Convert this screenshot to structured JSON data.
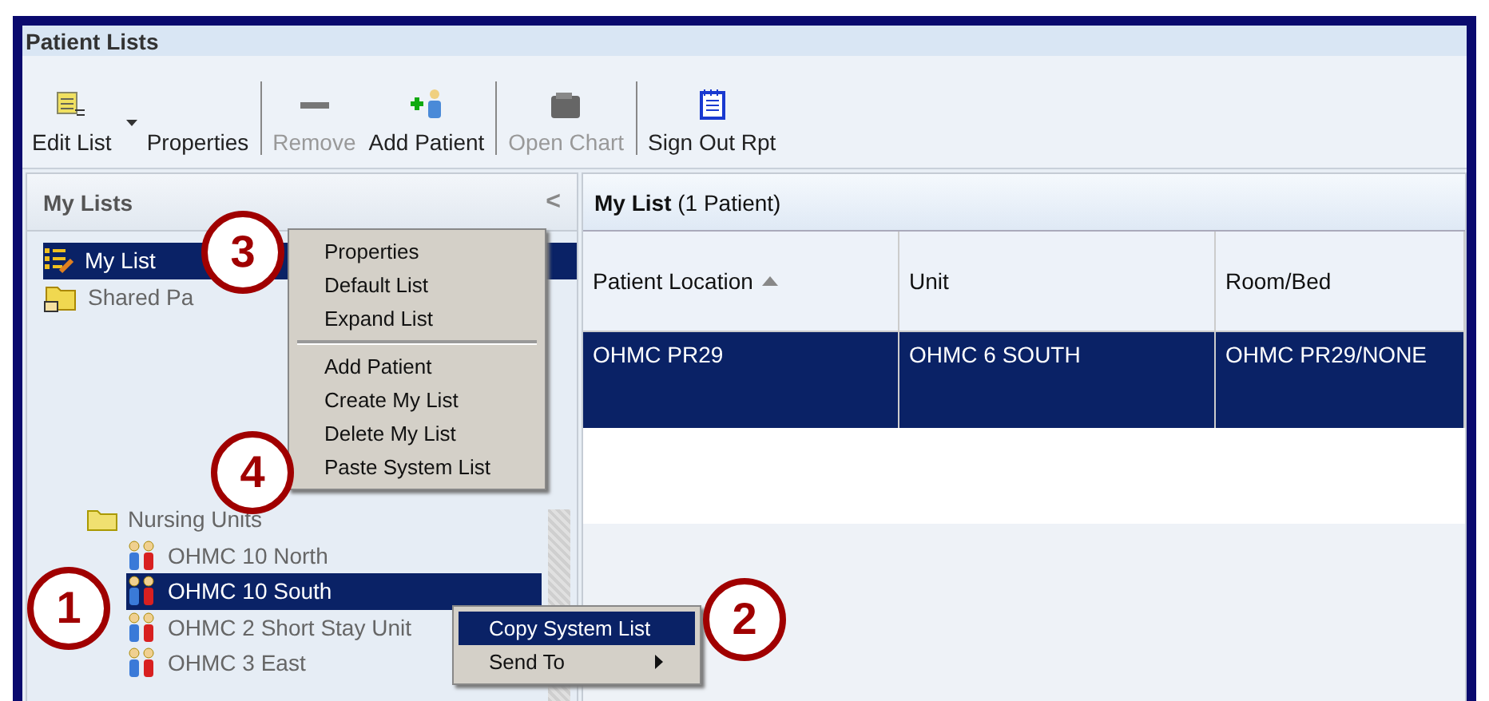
{
  "window": {
    "title": "Patient Lists"
  },
  "toolbar": [
    {
      "label": "Edit List",
      "disabled": false,
      "has_dropdown": true,
      "kind": "edit-list"
    },
    {
      "label": "Properties",
      "disabled": false,
      "kind": "none"
    },
    {
      "label": "Remove",
      "disabled": true,
      "kind": "remove"
    },
    {
      "label": "Add Patient",
      "disabled": false,
      "kind": "add-patient"
    },
    {
      "label": "Open Chart",
      "disabled": true,
      "kind": "chart"
    },
    {
      "label": "Sign Out Rpt",
      "disabled": false,
      "kind": "report"
    }
  ],
  "sidebar": {
    "title": "My Lists",
    "collapse_glyph": "<",
    "lists": [
      {
        "label": "My List",
        "selected": true,
        "kind": "list"
      },
      {
        "label": "Shared Pa",
        "selected": false,
        "kind": "shared"
      }
    ],
    "units": {
      "label": "Nursing Units",
      "children": [
        {
          "label": "OHMC 10 North",
          "selected": false
        },
        {
          "label": "OHMC 10 South",
          "selected": true
        },
        {
          "label": "OHMC 2 Short Stay Unit",
          "selected": false
        },
        {
          "label": "OHMC 3 East",
          "selected": false
        }
      ]
    }
  },
  "list_panel": {
    "title": "**My List** (1 Patient)",
    "columns": [
      {
        "label": "Patient Location",
        "sorted": true
      },
      {
        "label": "Unit",
        "sorted": false
      },
      {
        "label": "Room/Bed",
        "sorted": false
      }
    ],
    "rows": [
      {
        "cells": [
          "OHMC PR29",
          "OHMC 6 SOUTH",
          "OHMC PR29/NONE"
        ],
        "selected": true
      }
    ]
  },
  "list_menu": [
    {
      "label": "Properties"
    },
    {
      "label": "Default List"
    },
    {
      "label": "Expand List",
      "separator_after": true
    },
    {
      "label": "Add Patient"
    },
    {
      "label": "Create My List"
    },
    {
      "label": "Delete My List"
    },
    {
      "label": "Paste System List"
    }
  ],
  "unit_menu": [
    {
      "label": "Copy System List",
      "selected": true,
      "submenu": false
    },
    {
      "label": "Send To",
      "selected": false,
      "submenu": true
    }
  ],
  "callouts": [
    "3",
    "4",
    "1",
    "2"
  ]
}
